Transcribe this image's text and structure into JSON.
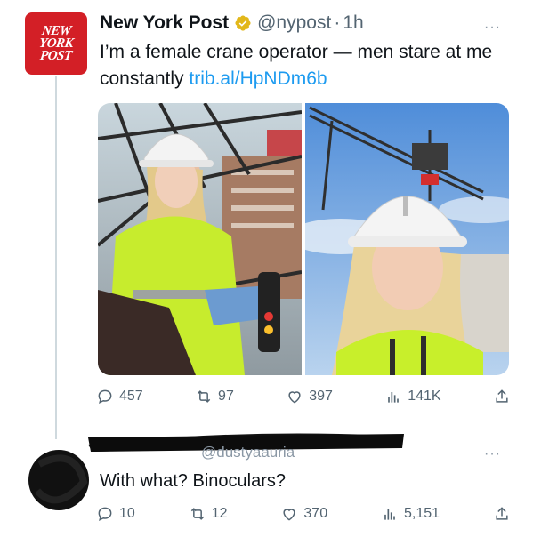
{
  "tweet": {
    "author_name": "New York Post",
    "handle": "@nypost",
    "separator": "·",
    "time": "1h",
    "avatar_lines": [
      "NEW",
      "YORK",
      "POST"
    ],
    "text": "I’m a female crane operator — men stare at me constantly ",
    "link": "trib.al/HpNDm6b",
    "more": "···",
    "stats": {
      "replies": "457",
      "reposts": "97",
      "likes": "397",
      "views": "141K"
    },
    "icons": [
      "verified-icon",
      "reply-icon",
      "repost-icon",
      "like-icon",
      "views-icon",
      "share-icon"
    ]
  },
  "reply": {
    "handle": "@dustyaauria",
    "text": "With what? Binoculars?",
    "more": "···",
    "stats": {
      "replies": "10",
      "reposts": "12",
      "likes": "370",
      "views": "5,151"
    }
  },
  "colors": {
    "nyp_red": "#d31f26",
    "link_blue": "#1d9bf0",
    "verified_gold": "#e2b719",
    "muted_gray": "#536471"
  }
}
